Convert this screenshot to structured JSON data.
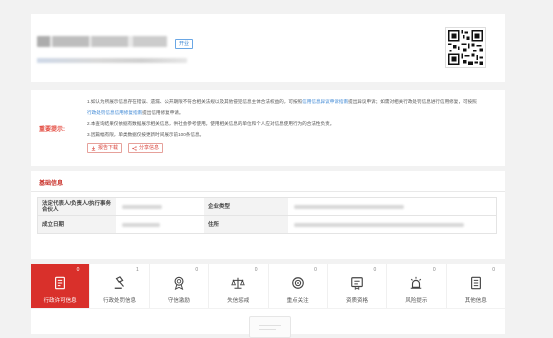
{
  "breadcrumb": "",
  "header": {
    "company_name": "",
    "status_tag": "开业",
    "company_subtitle": ""
  },
  "notice": {
    "label": "重要提示:",
    "line1_a": "1.如认为所展示信息存在错误、遗漏、公开期限不符合相关法规以及其他侵犯信息主体合法权益的，可按照",
    "line1_link": "信用信息异议申诉指南",
    "line1_b": "提出异议申诉；如需对相关行政处罚信息进行信用修复，可按照",
    "line2_link": "行政处罚信息信用修复指南",
    "line2_b": "提出信用修复申请。",
    "line3": "2.本查询结果仅依据有数据展示相关信息，供社会参考使用。使用相关信息的单位和个人应对信息使用行为的合法性负责。",
    "line4": "3.因篇幅有限，单类数据仅按更新时间展示前100条信息。",
    "btn_report": "报告下载",
    "btn_share": "分享信息"
  },
  "basic": {
    "title": "基础信息",
    "rows": [
      {
        "label1": "法定代表人/负责人/执行事务合伙人",
        "label2": "企业类型"
      },
      {
        "label1": "成立日期",
        "label2": "住所"
      }
    ]
  },
  "tabs": [
    {
      "label": "行政许可信息",
      "count": "0",
      "icon": "license-doc-icon",
      "active": true
    },
    {
      "label": "行政处罚信息",
      "count": "1",
      "icon": "gavel-icon",
      "active": false
    },
    {
      "label": "守信激励",
      "count": "0",
      "icon": "medal-icon",
      "active": false
    },
    {
      "label": "失信惩戒",
      "count": "0",
      "icon": "scale-icon",
      "active": false
    },
    {
      "label": "重点关注",
      "count": "0",
      "icon": "target-icon",
      "active": false
    },
    {
      "label": "资质资格",
      "count": "0",
      "icon": "certificate-icon",
      "active": false
    },
    {
      "label": "风险提示",
      "count": "0",
      "icon": "alarm-icon",
      "active": false
    },
    {
      "label": "其他信息",
      "count": "0",
      "icon": "list-doc-icon",
      "active": false
    }
  ],
  "colors": {
    "accent_red": "#d9302b",
    "link_blue": "#3b86d4"
  }
}
